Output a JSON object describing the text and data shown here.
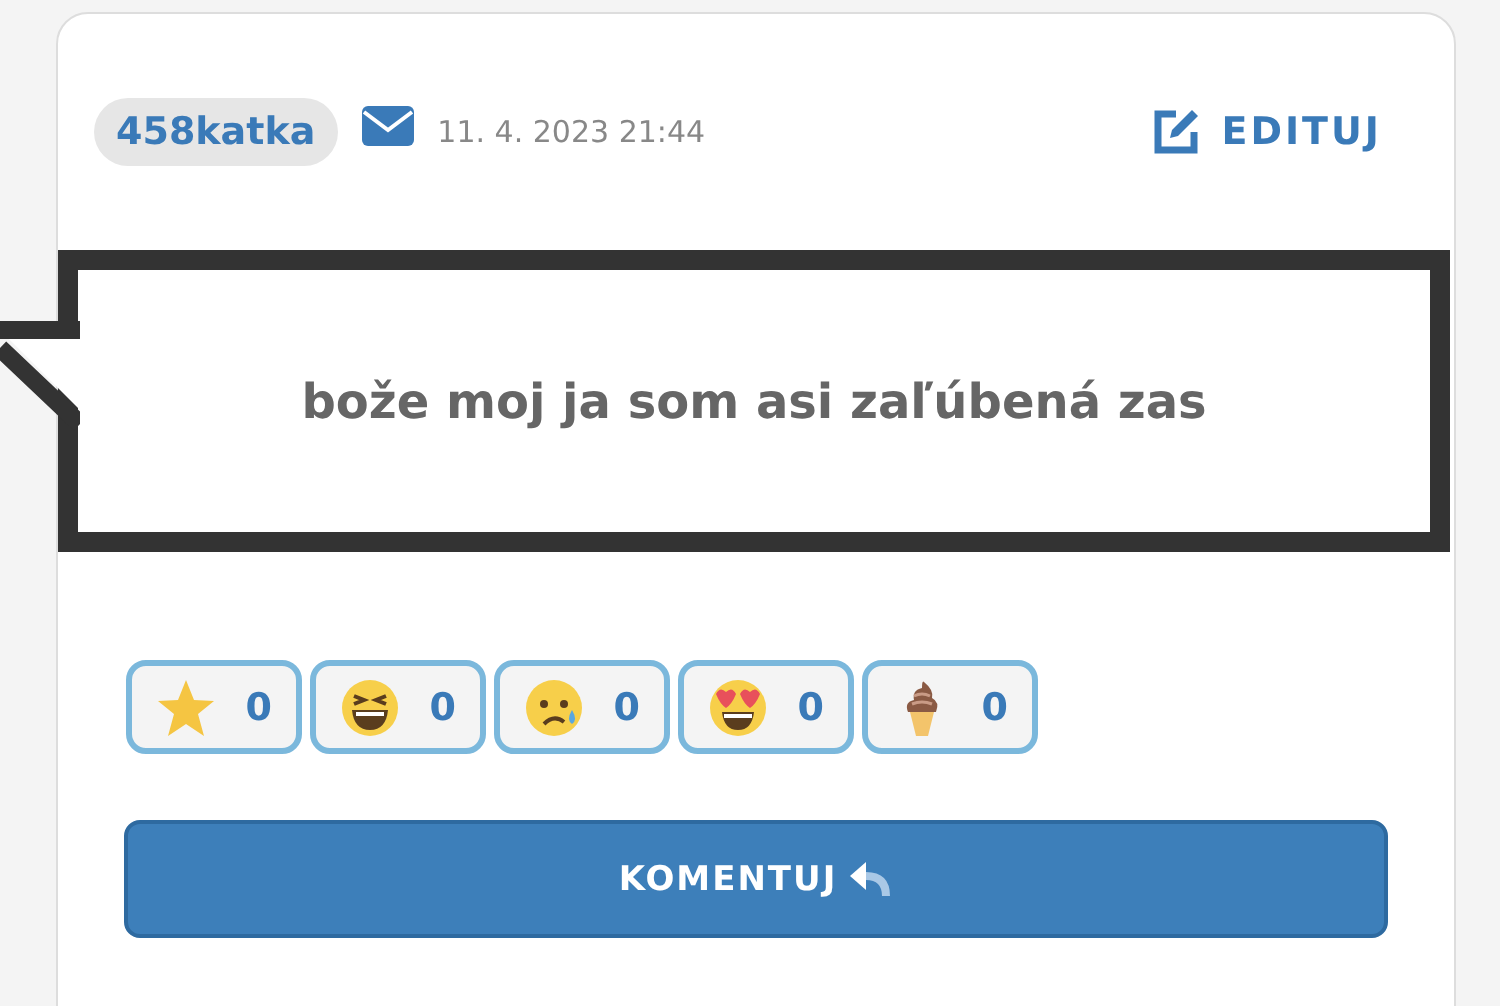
{
  "post": {
    "author": "458katka",
    "timestamp": "11. 4. 2023 21:44",
    "edit_label": "EDITUJ",
    "message": "bože moj ja som asi zaľúbená zas"
  },
  "reactions": [
    {
      "kind": "star",
      "count": "0"
    },
    {
      "kind": "laugh",
      "count": "0"
    },
    {
      "kind": "sad",
      "count": "0"
    },
    {
      "kind": "love",
      "count": "0"
    },
    {
      "kind": "icecream",
      "count": "0"
    }
  ],
  "comment_button": "KOMENTUJ"
}
